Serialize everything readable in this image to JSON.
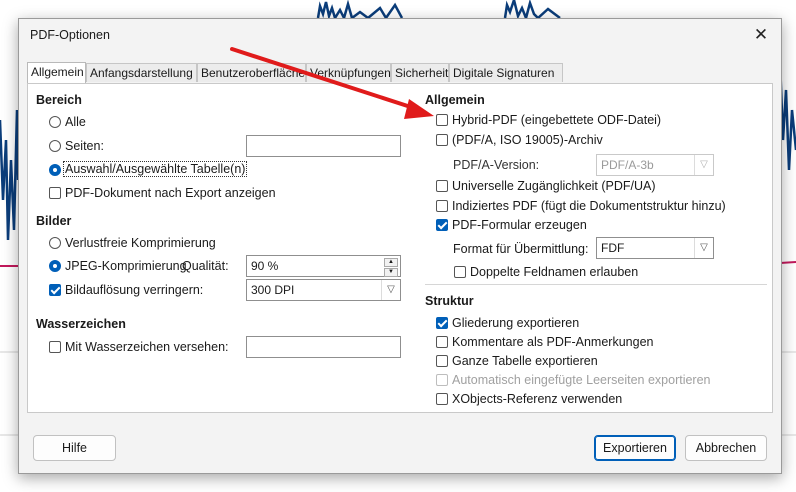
{
  "dialog": {
    "title": "PDF-Optionen",
    "close_glyph": "✕"
  },
  "tabs": [
    {
      "label": "Allgemein",
      "active": true
    },
    {
      "label": "Anfangsdarstellung"
    },
    {
      "label": "Benutzeroberfläche"
    },
    {
      "label": "Verknüpfungen"
    },
    {
      "label": "Sicherheit"
    },
    {
      "label": "Digitale Signaturen"
    }
  ],
  "bereich": {
    "heading": "Bereich",
    "all_label": "Alle",
    "pages_label": "Seiten:",
    "pages_value": "",
    "selection_label": "Auswahl/Ausgewählte Tabelle(n)",
    "view_after_export_label": "PDF-Dokument nach Export anzeigen"
  },
  "bilder": {
    "heading": "Bilder",
    "lossless_label": "Verlustfreie Komprimierung",
    "jpeg_label": "JPEG-Komprimierung",
    "quality_label": "Qualität:",
    "quality_value": "90 %",
    "reduce_resolution_label": "Bildauflösung verringern:",
    "resolution_value": "300 DPI"
  },
  "wasserzeichen": {
    "heading": "Wasserzeichen",
    "sign_label": "Mit Wasserzeichen versehen:",
    "sign_value": ""
  },
  "allgemein": {
    "heading": "Allgemein",
    "hybrid_label": "Hybrid-PDF (eingebettete ODF-Datei)",
    "pdfa_label": "(PDF/A, ISO 19005)-Archiv",
    "pdfa_version_label": "PDF/A-Version:",
    "pdfa_version_value": "PDF/A-3b",
    "ua_label": "Universelle Zugänglichkeit (PDF/UA)",
    "tagged_label": "Indiziertes PDF (fügt die Dokumentstruktur hinzu)",
    "form_label": "PDF-Formular erzeugen",
    "submit_format_label": "Format für Übermittlung:",
    "submit_format_value": "FDF",
    "duplicate_names_label": "Doppelte Feldnamen erlauben"
  },
  "struktur": {
    "heading": "Struktur",
    "outline_label": "Gliederung exportieren",
    "comments_label": "Kommentare als PDF-Anmerkungen",
    "whole_sheet_label": "Ganze Tabelle exportieren",
    "auto_blank_label": "Automatisch eingefügte Leerseiten exportieren",
    "xobjects_label": "XObjects-Referenz verwenden"
  },
  "footer": {
    "help_label": "Hilfe",
    "export_label": "Exportieren",
    "cancel_label": "Abbrechen"
  },
  "colors": {
    "accent": "#005fb8",
    "annotation_arrow": "#e01b1b",
    "chart_line": "#0b3d7a",
    "chart_trend": "#c2185b"
  }
}
